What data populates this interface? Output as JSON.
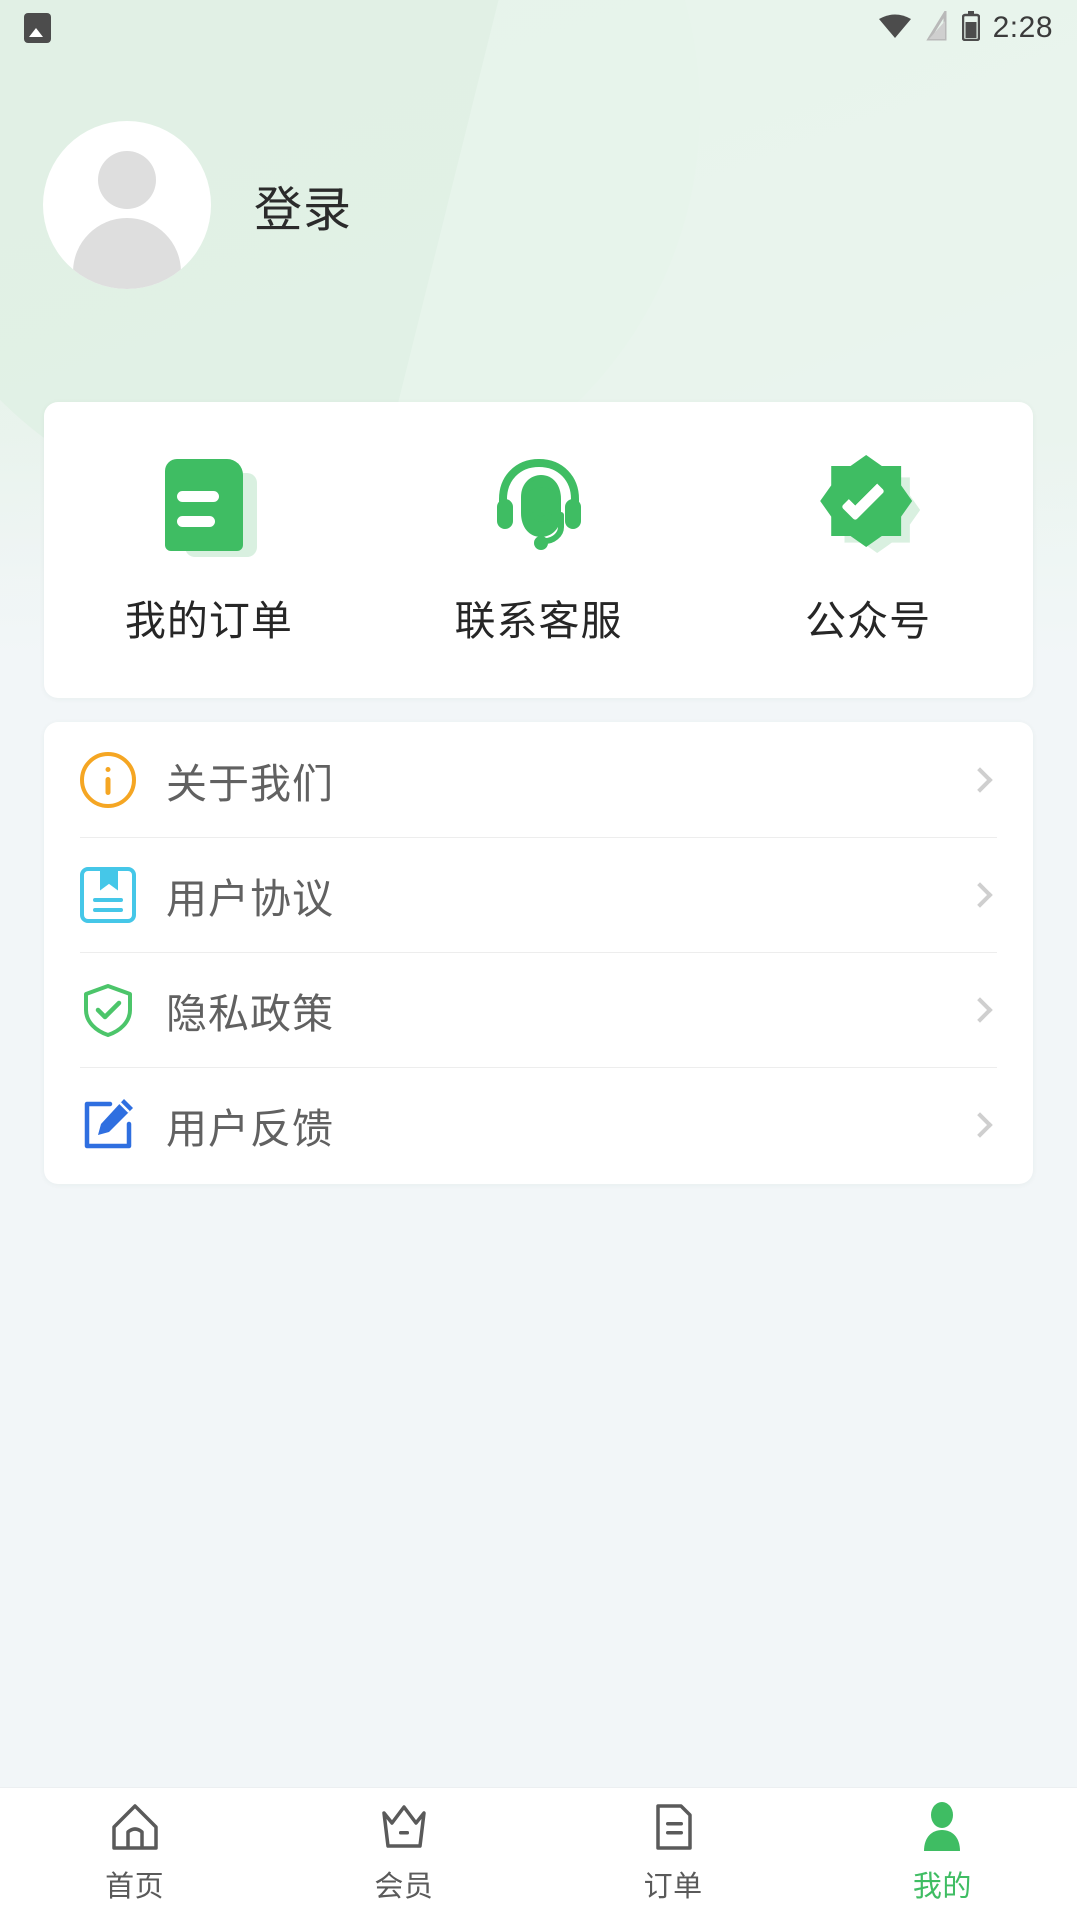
{
  "status_bar": {
    "left_icon": "photo-icon",
    "icons": [
      "wifi-icon",
      "signal-off-icon",
      "battery-icon"
    ],
    "time": "2:28"
  },
  "theme": {
    "accent": "#3fbd63",
    "page_bg": "#f2f6f8",
    "card_bg": "#ffffff",
    "header_green": "#dff0e4",
    "info_orange": "#f5a623",
    "agreement_cyan": "#45c7e8",
    "privacy_green": "#4cc56a",
    "feedback_blue": "#2f6fe0",
    "text_primary": "#262626",
    "text_secondary": "#616161",
    "chevron": "#cfcfcf"
  },
  "profile": {
    "avatar": "default-avatar",
    "login_label": "登录"
  },
  "quick_actions": [
    {
      "icon": "order-document-icon",
      "label": "我的订单"
    },
    {
      "icon": "customer-service-headset-icon",
      "label": "联系客服"
    },
    {
      "icon": "verified-badge-icon",
      "label": "公众号"
    }
  ],
  "menu_items": [
    {
      "icon": "info-circle-icon",
      "label": "关于我们",
      "chevron": "chevron-right-icon"
    },
    {
      "icon": "agreement-book-icon",
      "label": "用户协议",
      "chevron": "chevron-right-icon"
    },
    {
      "icon": "shield-check-icon",
      "label": "隐私政策",
      "chevron": "chevron-right-icon"
    },
    {
      "icon": "edit-pencil-icon",
      "label": "用户反馈",
      "chevron": "chevron-right-icon"
    }
  ],
  "tabbar": {
    "items": [
      {
        "icon": "home-icon",
        "label": "首页",
        "active": false
      },
      {
        "icon": "crown-icon",
        "label": "会员",
        "active": false
      },
      {
        "icon": "order-list-icon",
        "label": "订单",
        "active": false
      },
      {
        "icon": "person-icon",
        "label": "我的",
        "active": true
      }
    ]
  }
}
